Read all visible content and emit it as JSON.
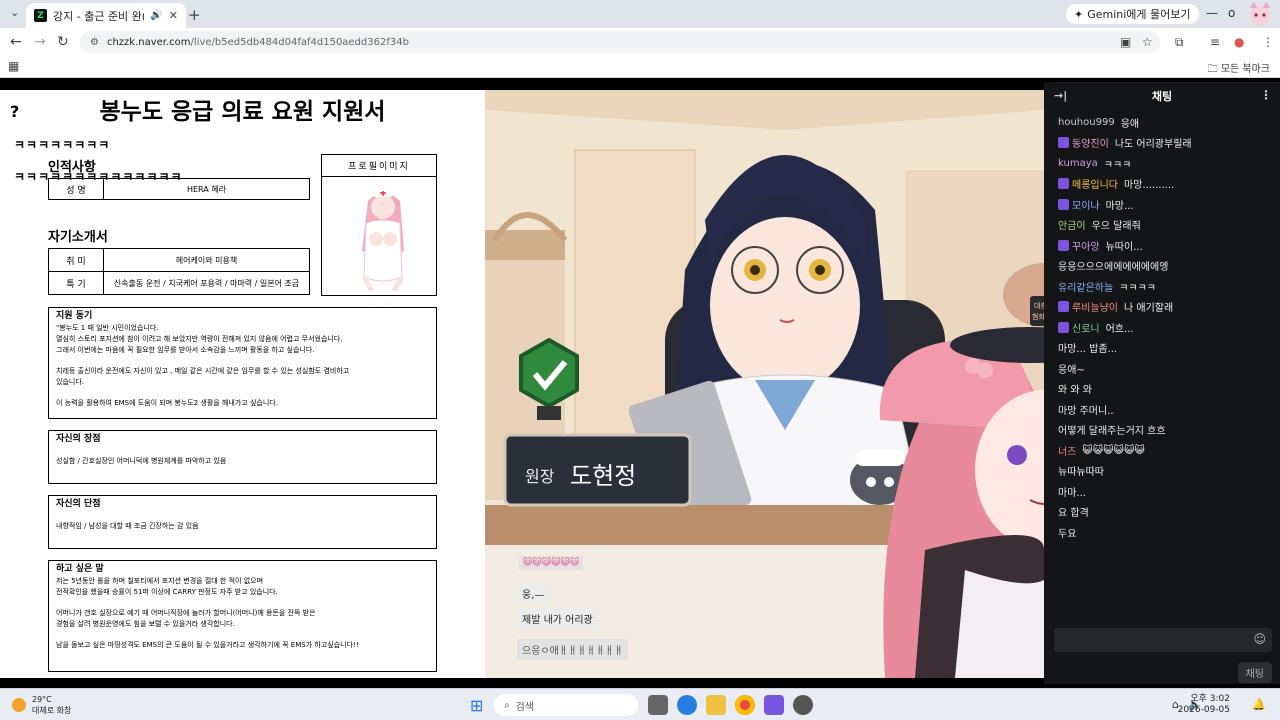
{
  "browser": {
    "tab_title": "강지 - 출근 준비 완(ﾟㅁﾟ;",
    "url_site": "chzzk.naver.com",
    "url_path": "/live/b5ed5db484d04faf4d150aedd362f34b",
    "gemini_label": "Gemini에게 물어보기",
    "all_bookmarks": "모든 북마크"
  },
  "document": {
    "title": "봉누도 응급 의료 요원 지원서",
    "kk_line1": "ㅋㅋㅋㅋㅋㅋㅋㅋ",
    "kk_line2": "ㅋㅋㅋㅋㅋㅋㅋㅋㅋㅋㅋㅋㅋㅋ",
    "personal_header": "인적사항",
    "name_label": "성 명",
    "name_value": "HERA 혜라",
    "profile_label": "프로필이미지",
    "intro_header": "자기소개서",
    "hobby_label": "취 미",
    "hobby_value": "헤어케이와 미용책",
    "skill_label": "특 기",
    "skill_value": "신속출동 운전 / 치국케어 포용력 / 마마력 / 일본어 조금",
    "motivation_header": "지원 동기",
    "motivation_lines": [
      "\"봉누도 1 때 일반 시민이었습니다.",
      "열심히 스토리 포지션에 참이 이려고 해 보았지만 역량이 전해져 있지 않음에 어렵고 무서웠습니다.",
      "그래서 이번에는 마음에 꼭 필요한 임무를 받아서 소속감을 느끼며 활동을 하고 싶습니다.",
      "",
      "치레등 출신이라 운전에도 자신이 있고 , 메일 같은 시간에 같은 임무를 할 수 있는 성실함도 겸비하고",
      "있습니다.",
      "",
      "이 능력을 활용하여 EMS에 도움이 되며 봉누도2 생활을 해내가고 싶습니다."
    ],
    "strength_header": "자신의 장점",
    "strength_text": "성실함 / 간호실장인 어머니덕에 병원체계를 파악하고 있음",
    "weakness_header": "자신의 단점",
    "weakness_text": "내향적임 / 남성을 대할 때 조금 긴장하는 감 있음",
    "wish_header": "하고 싶은 말",
    "wish_lines": [
      "저는 5년동안 롤을 하며 칠포티에서 포지션 변경을 절대 한 적이 없으며",
      "전적확인을 했을때 승률이 51퍼 이상에 CARRY 판정도 자주 받고 있습니다.",
      "",
      "어머니가 갠호 실장으로 예기 때 어머니직장에 놀러가 할머니(어머니)께 용돈을 잔뜩 받은",
      "경험을 살려 병원운영에도 힘을 보탤 수 있을거라 생각합니다.",
      "",
      "남을 돌보고 싶은 마땅성격도 EMS의 큰 도움이 될 수 있을거라고 생각하기에 꼭 EMS가 하고싶습니다!!"
    ]
  },
  "scene": {
    "nameplate_title": "원장",
    "nameplate_name": "도현정",
    "subtitle1": "웅,—",
    "subtitle2": "제발 내가 어리광",
    "subtitle3": "으응ㅇ애ㅐㅐㅐㅐㅐㅐㅐ",
    "emote_strip": "😺😺😺😺😺😺",
    "sign_text": "대충 혐화이"
  },
  "chat": {
    "header": "채팅",
    "send_label": "채팅",
    "messages": [
      {
        "nick": "houhou999",
        "text": "응애",
        "color": "#c9c9c9",
        "badge": false
      },
      {
        "nick": "동양진이",
        "text": "나도 어리광부릴래",
        "color": "#e6a0c8",
        "badge": true
      },
      {
        "nick": "kumaya",
        "text": "ㅋㅋㅋ",
        "color": "#c9a0e6",
        "badge": false
      },
      {
        "nick": "메롱입니다",
        "text": "마망..........",
        "color": "#f2c14e",
        "badge": true
      },
      {
        "nick": "모이나",
        "text": "마망...",
        "color": "#8ab4f8",
        "badge": true
      },
      {
        "nick": "안금이",
        "text": "우으 달래줘",
        "color": "#b0d68a",
        "badge": false
      },
      {
        "nick": "꾸아앙",
        "text": "뉴따이...",
        "color": "#c9a0e6",
        "badge": true
      },
      {
        "nick": "",
        "text": "응응으으으에에에에에에엥",
        "color": "#c9c9c9",
        "badge": false
      },
      {
        "nick": "유리같은하늘",
        "text": "ㅋㅋㅋㅋ",
        "color": "#8ab4f8",
        "badge": false
      },
      {
        "nick": "루비늘냥이",
        "text": "나 애기할래",
        "color": "#f28b82",
        "badge": true
      },
      {
        "nick": "신로니",
        "text": "어흐...",
        "color": "#81c995",
        "badge": true
      },
      {
        "nick": "",
        "text": "마망... 밥좀...",
        "color": "#c9c9c9",
        "badge": false
      },
      {
        "nick": "",
        "text": "응애~",
        "color": "#c9c9c9",
        "badge": false
      },
      {
        "nick": "",
        "text": "와 와 와",
        "color": "#c9c9c9",
        "badge": false
      },
      {
        "nick": "",
        "text": "마망 주머니..",
        "color": "#c9c9c9",
        "badge": false
      },
      {
        "nick": "",
        "text": "어떻게 달래주는거지 흐흐",
        "color": "#c9c9c9",
        "badge": false
      },
      {
        "nick": "너즈",
        "text": "😺😺😺😺😺😺",
        "color": "#f28b82",
        "badge": false
      },
      {
        "nick": "",
        "text": "뉴따뉴따따",
        "color": "#c9c9c9",
        "badge": false
      },
      {
        "nick": "",
        "text": "마마...",
        "color": "#c9c9c9",
        "badge": false
      },
      {
        "nick": "",
        "text": "요 합격",
        "color": "#c9c9c9",
        "badge": false
      },
      {
        "nick": "",
        "text": "두요",
        "color": "#c9c9c9",
        "badge": false
      }
    ]
  },
  "taskbar": {
    "weather_temp": "29°C",
    "weather_desc": "대체로 화창",
    "search_placeholder": "검색",
    "time": "오후 3:02",
    "date": "2026-09-05"
  },
  "colors": {
    "chat_bg": "#141517",
    "chzzk_green": "#2ee06a",
    "badge_purple": "#7b55e0"
  }
}
